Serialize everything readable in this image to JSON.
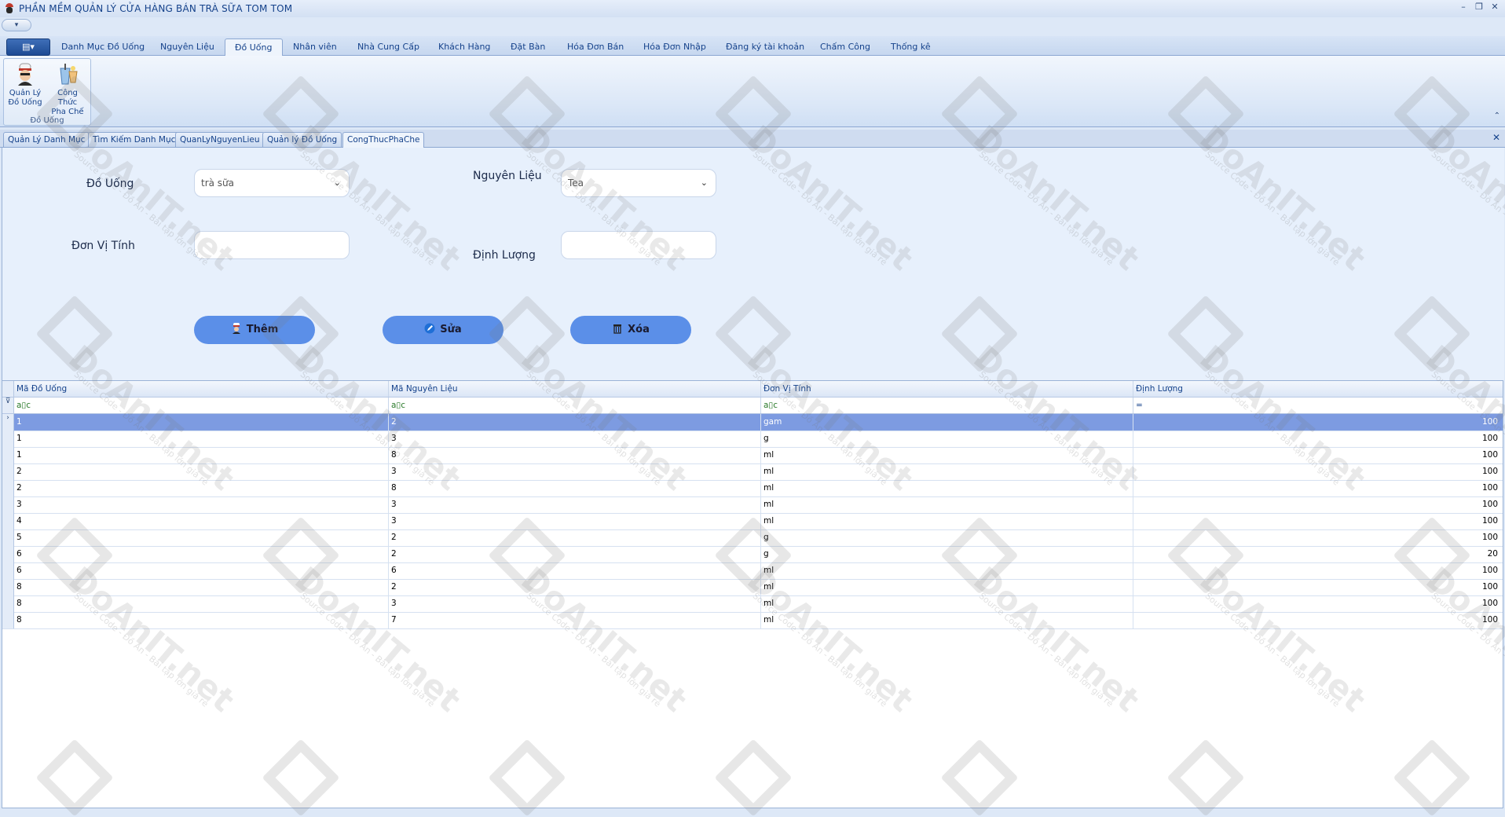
{
  "window": {
    "title": "PHẦN MỀM QUẢN LÝ CỬA HÀNG BÁN TRÀ SỮA TOM TOM",
    "controls": [
      "–",
      "❐",
      "✕"
    ]
  },
  "quick_access": "▾",
  "ribbon": {
    "app_button": "▤▾",
    "tabs": [
      "Danh Mục Đồ Uống",
      "Nguyên Liệu",
      "Đồ Uống",
      "Nhân viên",
      "Nhà Cung Cấp",
      "Khách Hàng",
      "Đặt Bàn",
      "Hóa Đơn Bán",
      "Hóa Đơn Nhập",
      "Đăng ký tài khoản",
      "Chấm Công",
      "Thống kê"
    ],
    "active_tab": "Đồ Uống",
    "group": {
      "label": "Đồ Uống",
      "buttons": [
        {
          "line1": "Quản Lý",
          "line2": "Đồ Uống",
          "icon": "chef-icon"
        },
        {
          "line1": "Công Thức",
          "line2": "Pha Chế",
          "icon": "drink-cup-icon"
        }
      ]
    },
    "collapse": "⌃"
  },
  "doc_tabs": {
    "items": [
      "Quản Lý Danh Mục",
      "Tìm Kiếm Danh Mục",
      "QuanLyNguyenLieu",
      "Quản lý Đồ Uống",
      "CongThucPhaChe"
    ],
    "active": "CongThucPhaChe",
    "close": "✕"
  },
  "form": {
    "do_uong_label": "Đồ Uống",
    "do_uong_value": "trà sữa",
    "nguyen_lieu_label": "Nguyên Liệu",
    "nguyen_lieu_value": "Tea",
    "don_vi_tinh_label": "Đơn Vị Tính",
    "don_vi_tinh_value": "",
    "dinh_luong_label": "Định Lượng",
    "dinh_luong_value": "",
    "chevron": "⌄",
    "buttons": {
      "them": "Thêm",
      "sua": "Sửa",
      "xoa": "Xóa"
    }
  },
  "grid": {
    "columns": [
      "Mã Đồ Uống",
      "Mã Nguyên Liệu",
      "Đơn Vị Tính",
      "Định Lượng"
    ],
    "filter_row": [
      "a▯c",
      "a▯c",
      "a▯c",
      "="
    ],
    "filter_icon": "⊽",
    "row_indicator": "›",
    "rows": [
      [
        "1",
        "2",
        "gam",
        "100"
      ],
      [
        "1",
        "3",
        "g",
        "100"
      ],
      [
        "1",
        "8",
        "ml",
        "100"
      ],
      [
        "2",
        "3",
        "ml",
        "100"
      ],
      [
        "2",
        "8",
        "ml",
        "100"
      ],
      [
        "3",
        "3",
        "ml",
        "100"
      ],
      [
        "4",
        "3",
        "ml",
        "100"
      ],
      [
        "5",
        "2",
        "g",
        "100"
      ],
      [
        "6",
        "2",
        "g",
        "20"
      ],
      [
        "6",
        "6",
        "ml",
        "100"
      ],
      [
        "8",
        "2",
        "ml",
        "100"
      ],
      [
        "8",
        "3",
        "ml",
        "100"
      ],
      [
        "8",
        "7",
        "ml",
        "100"
      ]
    ],
    "selected_row": 0
  },
  "watermark": {
    "text": "DoAnIT.net",
    "subtext": "Source Code - Đồ Án - Bài tập lớn giá rẻ"
  }
}
